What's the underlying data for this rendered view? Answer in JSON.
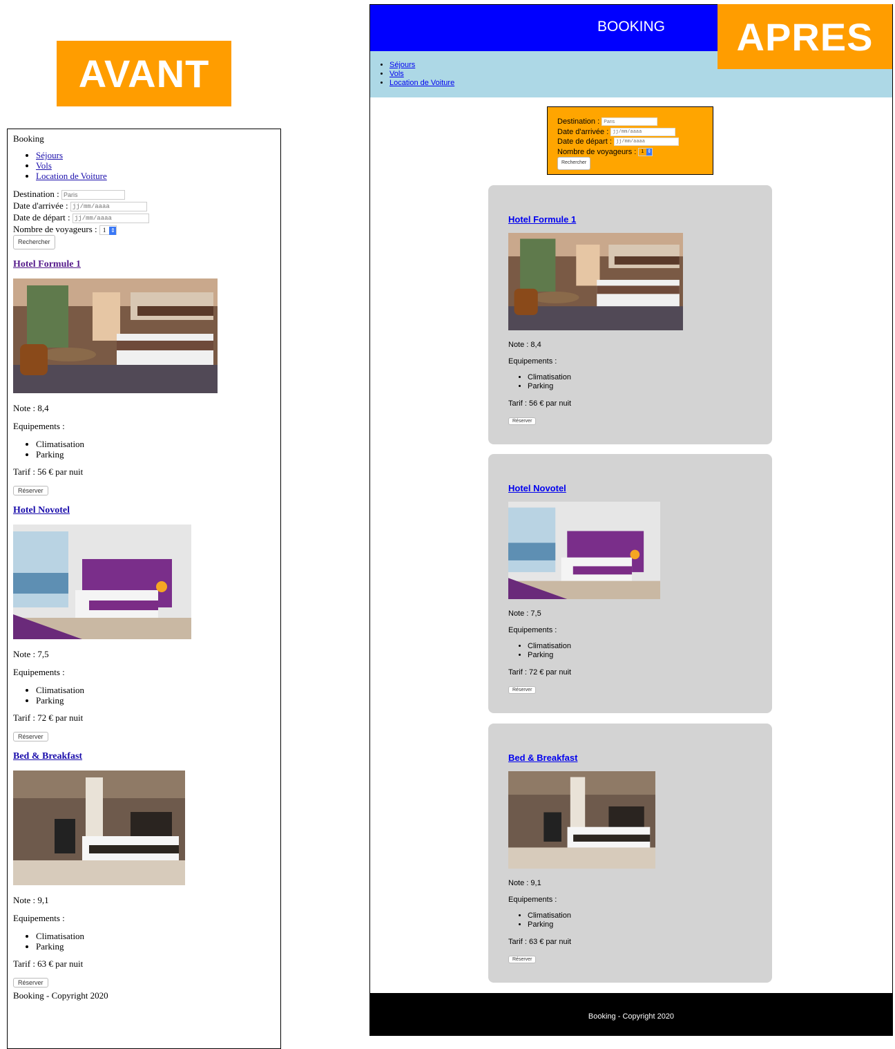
{
  "badges": {
    "before": "AVANT",
    "after": "APRES"
  },
  "site": {
    "title_before": "Booking",
    "title_after": "BOOKING"
  },
  "nav": [
    "Séjours",
    "Vols",
    "Location de Voiture"
  ],
  "search": {
    "destination_label": "Destination :",
    "destination_placeholder": "Paris",
    "arrival_label": "Date d'arrivée :",
    "departure_label": "Date de départ :",
    "date_placeholder": "jj/mm/aaaa",
    "travellers_label": "Nombre de voyageurs :",
    "travellers_value": "1",
    "submit": "Rechercher"
  },
  "hotels": [
    {
      "name": "Hotel Formule 1",
      "note": "Note : 8,4",
      "equip_label": "Equipements :",
      "equipments": [
        "Climatisation",
        "Parking"
      ],
      "tarif": "Tarif : 56 € par nuit",
      "button": "Réserver"
    },
    {
      "name": "Hotel Novotel",
      "note": "Note : 7,5",
      "equip_label": "Equipements :",
      "equipments": [
        "Climatisation",
        "Parking"
      ],
      "tarif": "Tarif : 72 € par nuit",
      "button": "Réserver"
    },
    {
      "name": "Bed & Breakfast",
      "note": "Note : 9,1",
      "equip_label": "Equipements :",
      "equipments": [
        "Climatisation",
        "Parking"
      ],
      "tarif": "Tarif : 63 € par nuit",
      "button": "Réserver"
    }
  ],
  "footer": "Booking - Copyright 2020",
  "colors": {
    "badge": "#ff9d00",
    "header": "#0000ff",
    "nav": "#add8e6",
    "form": "#ffa500",
    "card": "#d3d3d3",
    "footer": "#000000"
  }
}
